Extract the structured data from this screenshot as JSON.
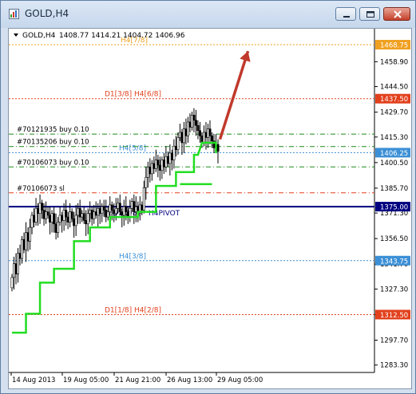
{
  "window": {
    "title": "GOLD,H4",
    "minimize_icon": "minimize-icon",
    "restore_icon": "restore-icon",
    "close_icon": "close-icon"
  },
  "chart_header": {
    "symbol": "GOLD,H4",
    "ohlc": "1408.77 1414.21 1404.72 1406.96"
  },
  "chart_data": {
    "type": "candlestick",
    "price_axis_ticks": [
      "1458.90",
      "1444.50",
      "1429.70",
      "1415.30",
      "1400.50",
      "1385.70",
      "1371.30",
      "1356.50",
      "1341.70",
      "1327.30",
      "1312.50",
      "1297.70",
      "1283.30"
    ],
    "time_axis_ticks": [
      "14 Aug 2013",
      "19 Aug 05:00",
      "21 Aug 21:00",
      "26 Aug 13:00",
      "29 Aug 05:00"
    ],
    "ylim": [
      1279,
      1478
    ],
    "levels": [
      {
        "label": "H4[7/8]",
        "price": 1468.75,
        "tag": "1468.75",
        "color": "#f0a020",
        "style": "dotted"
      },
      {
        "label": "D1[3/8] H4[6/8]",
        "price": 1437.5,
        "tag": "1437.50",
        "color": "#e2401c",
        "style": "dotted"
      },
      {
        "label": "H4[5/8]",
        "price": 1406.25,
        "tag": "1406.25",
        "color": "#3b8fd6",
        "style": "dotted"
      },
      {
        "label": "H4PIVOT",
        "price": 1375.0,
        "tag": "1375.00",
        "color": "#000080",
        "style": "solid"
      },
      {
        "label": "H4[3/8]",
        "price": 1343.75,
        "tag": "1343.75",
        "color": "#3b8fd6",
        "style": "dotted"
      },
      {
        "label": "D1[1/8] H4[2/8]",
        "price": 1312.5,
        "tag": "1312.50",
        "color": "#e2401c",
        "style": "dotted"
      }
    ],
    "pivot_label_prefix": "D1[2/8]",
    "pivot_label_ghost": "H4[3/8]",
    "orders": [
      {
        "label": "#70121935 buy 0.10",
        "price": 1417.0,
        "color": "#1a8a1a"
      },
      {
        "label": "#70135206 buy 0.10",
        "price": 1409.8,
        "color": "#1a8a1a"
      },
      {
        "label": "#70106073 buy 0.10",
        "price": 1398.0,
        "color": "#1a8a1a"
      },
      {
        "label": "#70106073 sl",
        "price": 1383.0,
        "color": "#e2401c"
      }
    ],
    "price_tags": [
      {
        "price": 1468.75,
        "text": "1468.75",
        "bg": "#f0a020"
      },
      {
        "price": 1437.5,
        "text": "1437.50",
        "bg": "#e2401c"
      },
      {
        "price": 1406.25,
        "text": "1406.25",
        "bg": "#3b8fd6"
      },
      {
        "price": 1375.0,
        "text": "1375.00",
        "bg": "#000080"
      },
      {
        "price": 1343.75,
        "text": "1343.75",
        "bg": "#3b8fd6"
      },
      {
        "price": 1312.5,
        "text": "1312.50",
        "bg": "#e2401c"
      }
    ],
    "stop_line": [
      {
        "i": 0,
        "v": 1302
      },
      {
        "i": 7,
        "v": 1302
      },
      {
        "i": 7,
        "v": 1313
      },
      {
        "i": 14,
        "v": 1313
      },
      {
        "i": 14,
        "v": 1331
      },
      {
        "i": 21,
        "v": 1331
      },
      {
        "i": 21,
        "v": 1339
      },
      {
        "i": 31,
        "v": 1339
      },
      {
        "i": 31,
        "v": 1355
      },
      {
        "i": 39,
        "v": 1355
      },
      {
        "i": 39,
        "v": 1363
      },
      {
        "i": 49,
        "v": 1363
      },
      {
        "i": 49,
        "v": 1369
      },
      {
        "i": 63,
        "v": 1369
      },
      {
        "i": 63,
        "v": 1372
      },
      {
        "i": 72,
        "v": 1372
      },
      {
        "i": 72,
        "v": 1387
      },
      {
        "i": 82,
        "v": 1387
      },
      {
        "i": 82,
        "v": 1395
      },
      {
        "i": 91,
        "v": 1395
      },
      {
        "i": 91,
        "v": 1405
      },
      {
        "i": 93,
        "v": 1405
      },
      {
        "i": 95,
        "v": 1412
      },
      {
        "i": 102,
        "v": 1412
      },
      {
        "i": 102,
        "v": 1406
      }
    ],
    "stop_line2": [
      {
        "i": 84,
        "v": 1388
      },
      {
        "i": 100,
        "v": 1388
      }
    ],
    "arrow": {
      "from": {
        "i": 104,
        "v": 1414
      },
      "to": {
        "i": 118,
        "v": 1465
      },
      "color": "#c0392b"
    },
    "candles_seed": [
      1334,
      1342,
      1336,
      1348,
      1345,
      1356,
      1350,
      1360,
      1355,
      1363,
      1370,
      1366,
      1374,
      1371,
      1377,
      1373,
      1368,
      1372,
      1370,
      1366,
      1371,
      1365,
      1360,
      1366,
      1370,
      1367,
      1373,
      1369,
      1366,
      1372,
      1368,
      1364,
      1370,
      1374,
      1369,
      1371,
      1367,
      1365,
      1371,
      1373,
      1368,
      1372,
      1370,
      1374,
      1371,
      1375,
      1373,
      1369,
      1372,
      1376,
      1373,
      1371,
      1374,
      1377,
      1372,
      1370,
      1375,
      1372,
      1369,
      1374,
      1378,
      1372,
      1375,
      1371,
      1376,
      1373,
      1386,
      1392,
      1398,
      1394,
      1400,
      1397,
      1402,
      1399,
      1396,
      1402,
      1398,
      1404,
      1400,
      1406,
      1402,
      1410,
      1408,
      1415,
      1418,
      1412,
      1420,
      1416,
      1424,
      1421,
      1428,
      1425,
      1422,
      1419,
      1416,
      1412,
      1418,
      1415,
      1420,
      1416,
      1413,
      1409,
      1411,
      1407
    ]
  }
}
